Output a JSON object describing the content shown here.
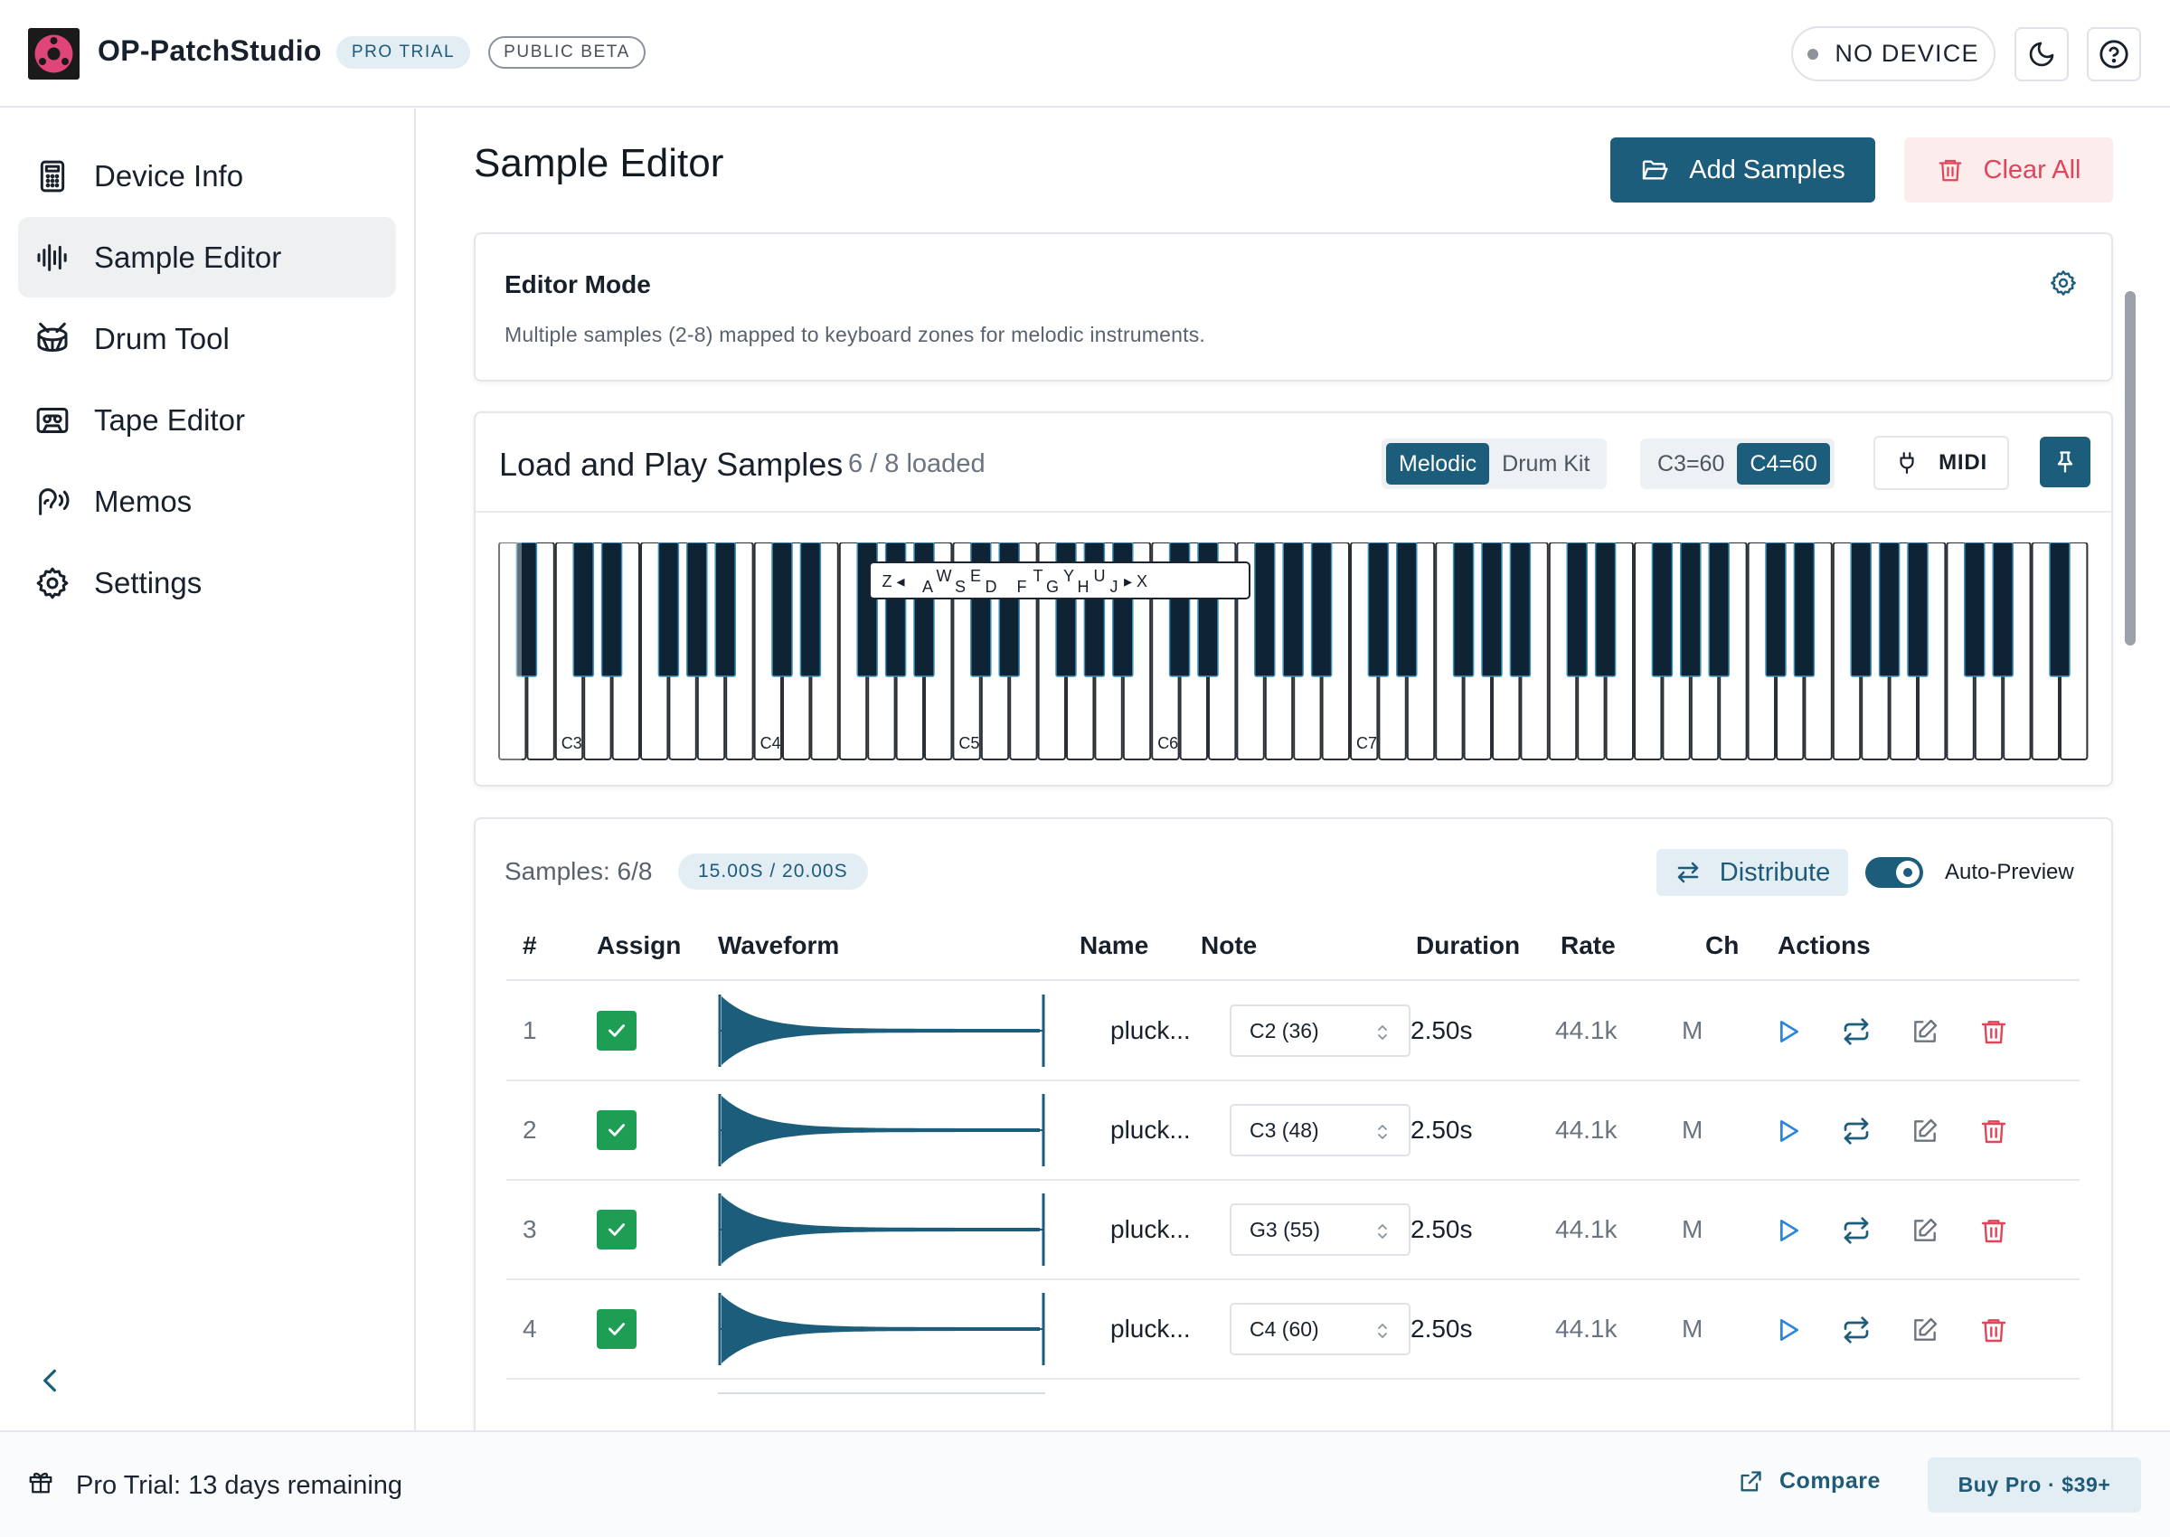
{
  "app": {
    "title": "OP-PatchStudio",
    "badges": {
      "trial": "PRO TRIAL",
      "beta": "PUBLIC BETA"
    },
    "device_status": "NO DEVICE",
    "theme_icon": "moon-icon",
    "help_icon": "help-circle-icon"
  },
  "sidebar": {
    "items": [
      {
        "label": "Device Info",
        "icon": "calculator-icon",
        "active": false
      },
      {
        "label": "Sample Editor",
        "icon": "waveform-icon",
        "active": true
      },
      {
        "label": "Drum Tool",
        "icon": "drum-icon",
        "active": false
      },
      {
        "label": "Tape Editor",
        "icon": "cassette-icon",
        "active": false
      },
      {
        "label": "Memos",
        "icon": "ear-sound-icon",
        "active": false
      },
      {
        "label": "Settings",
        "icon": "gear-icon",
        "active": false
      }
    ],
    "collapse_icon": "chevron-left-icon"
  },
  "main": {
    "title": "Sample Editor",
    "add_samples": "Add Samples",
    "clear_all": "Clear All"
  },
  "editor_mode": {
    "title": "Editor Mode",
    "description": "Multiple samples (2-8) mapped to keyboard zones for melodic instruments."
  },
  "keyboard_panel": {
    "title": "Load and Play Samples",
    "loaded": "6 / 8 loaded",
    "mode_options": [
      "Melodic",
      "Drum Kit"
    ],
    "mode_selected": "Melodic",
    "octave_options": [
      "C3=60",
      "C4=60"
    ],
    "octave_selected": "C4=60",
    "midi_label": "MIDI",
    "octave_labels": [
      "C3",
      "C4",
      "C5",
      "C6",
      "C7"
    ],
    "key_hints": {
      "left_arrow": "Z ◂",
      "white": [
        "A",
        "S",
        "D",
        "F",
        "G",
        "H",
        "J"
      ],
      "black": [
        "W",
        "E",
        "T",
        "Y",
        "U"
      ],
      "right_arrow": "▸ X"
    }
  },
  "samples_table": {
    "count_label": "Samples: 6/8",
    "duration_badge": "15.00S / 20.00S",
    "distribute": "Distribute",
    "auto_preview": "Auto-Preview",
    "auto_preview_on": true,
    "headers": [
      "#",
      "Assign",
      "Waveform",
      "Name",
      "Note",
      "Duration",
      "Rate",
      "Ch",
      "Actions"
    ],
    "rows": [
      {
        "num": "1",
        "assigned": true,
        "name": "pluck...",
        "note": "C2 (36)",
        "duration": "2.50s",
        "rate": "44.1k",
        "ch": "M"
      },
      {
        "num": "2",
        "assigned": true,
        "name": "pluck...",
        "note": "C3 (48)",
        "duration": "2.50s",
        "rate": "44.1k",
        "ch": "M"
      },
      {
        "num": "3",
        "assigned": true,
        "name": "pluck...",
        "note": "G3 (55)",
        "duration": "2.50s",
        "rate": "44.1k",
        "ch": "M"
      },
      {
        "num": "4",
        "assigned": true,
        "name": "pluck...",
        "note": "C4 (60)",
        "duration": "2.50s",
        "rate": "44.1k",
        "ch": "M"
      }
    ],
    "row_actions": [
      "play-icon",
      "repeat-icon",
      "edit-icon",
      "trash-icon"
    ]
  },
  "footer": {
    "trial_text": "Pro Trial: 13 days remaining",
    "compare": "Compare",
    "buy": "Buy Pro · $39+"
  },
  "colors": {
    "accent": "#1c5d7b",
    "accent_light": "#e2eef4",
    "danger": "#e0455a",
    "success": "#1e9e55",
    "play_blue": "#2b86d9"
  }
}
